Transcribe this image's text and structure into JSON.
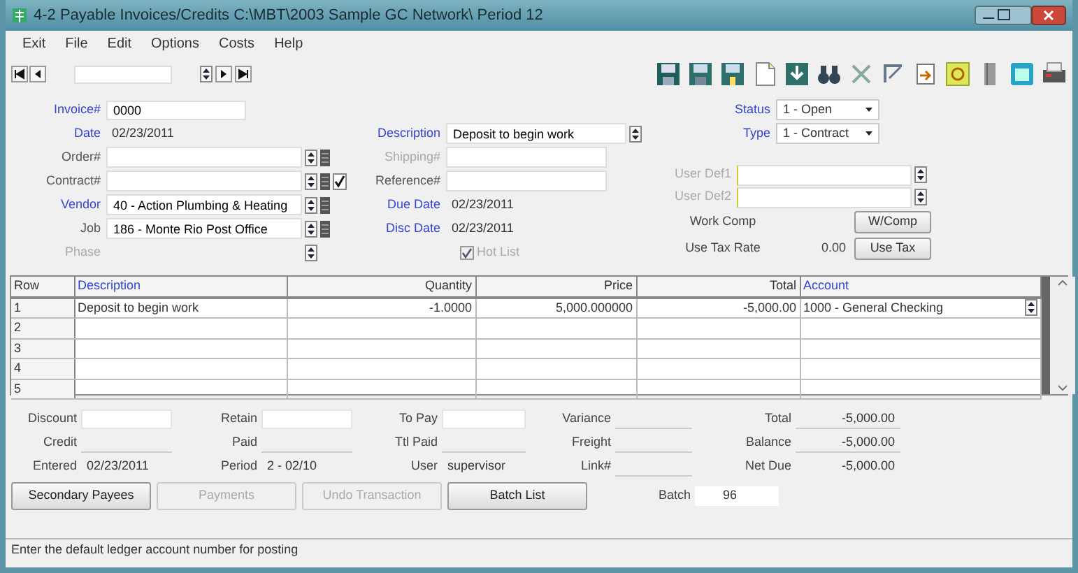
{
  "window": {
    "title": "4-2 Payable Invoices/Credits  C:\\MBT\\2003 Sample GC Network\\ Period 12"
  },
  "menu": [
    "Exit",
    "File",
    "Edit",
    "Options",
    "Costs",
    "Help"
  ],
  "left_fields": [
    {
      "label": "Invoice#",
      "value": "0000",
      "required": true,
      "disabled": false,
      "kind": "short_input",
      "lookup": false,
      "list": false,
      "check": false
    },
    {
      "label": "Date",
      "value": "02/23/2011",
      "required": true,
      "disabled": false,
      "kind": "text",
      "lookup": false,
      "list": false,
      "check": false
    },
    {
      "label": "Order#",
      "required": false,
      "disabled": false,
      "kind": "input",
      "lookup": true,
      "list": true,
      "check": false
    },
    {
      "label": "Contract#",
      "required": false,
      "disabled": false,
      "kind": "input",
      "lookup": true,
      "list": true,
      "check": true
    },
    {
      "label": "Vendor",
      "value": "40 - Action Plumbing & Heating",
      "required": true,
      "disabled": false,
      "kind": "input",
      "lookup": true,
      "list": true,
      "check": false
    },
    {
      "label": "Job",
      "value": "186 - Monte Rio Post Office",
      "required": false,
      "disabled": false,
      "kind": "input",
      "lookup": true,
      "list": true,
      "check": false
    },
    {
      "label": "Phase",
      "required": false,
      "disabled": true,
      "kind": "none",
      "lookup": true,
      "list": false,
      "check": false
    }
  ],
  "middle_fields": [
    {
      "label": "Description",
      "value": "Deposit to begin work",
      "required": true,
      "disabled": false,
      "kind": "wide_input"
    },
    {
      "label": "Shipping#",
      "required": false,
      "disabled": true,
      "kind": "input"
    },
    {
      "label": "Reference#",
      "required": false,
      "disabled": false,
      "kind": "input"
    },
    {
      "label": "Due Date",
      "value": "02/23/2011",
      "required": true,
      "disabled": false,
      "kind": "text"
    },
    {
      "label": "Disc Date",
      "value": "02/23/2011",
      "required": true,
      "disabled": false,
      "kind": "text"
    }
  ],
  "hot_list": {
    "label": "Hot List",
    "checked": true,
    "disabled": true
  },
  "status": {
    "label": "Status",
    "value": "1 - Open"
  },
  "type": {
    "label": "Type",
    "value": "1 - Contract"
  },
  "user_defs": [
    {
      "label": "User Def1"
    },
    {
      "label": "User Def2"
    }
  ],
  "work_comp": {
    "label": "Work Comp",
    "button": "W/Comp"
  },
  "use_tax": {
    "label": "Use Tax Rate",
    "value": "0.00",
    "button": "Use Tax"
  },
  "table": {
    "columns": [
      {
        "label": "Row",
        "link": false
      },
      {
        "label": "Description",
        "link": true
      },
      {
        "label": "Quantity",
        "link": false
      },
      {
        "label": "Price",
        "link": false
      },
      {
        "label": "Total",
        "link": false
      },
      {
        "label": "Account",
        "link": true
      }
    ],
    "rows": [
      {
        "row": "1",
        "description": "Deposit to begin work",
        "quantity": "-1.0000",
        "price": "5,000.000000",
        "total": "-5,000.00",
        "account": "1000 - General Checking"
      },
      {
        "row": "2"
      },
      {
        "row": "3"
      },
      {
        "row": "4"
      },
      {
        "row": "5"
      }
    ]
  },
  "totals": [
    [
      {
        "label": "Discount",
        "kind": "input"
      },
      {
        "label": "Retain",
        "kind": "input"
      },
      {
        "label": "To Pay",
        "kind": "input"
      },
      {
        "label": "Variance",
        "kind": "readonly"
      },
      {
        "label": "Total",
        "value": "-5,000.00",
        "kind": "readonly"
      }
    ],
    [
      {
        "label": "Credit",
        "kind": "readonly"
      },
      {
        "label": "Paid",
        "kind": "readonly"
      },
      {
        "label": "Ttl Paid",
        "kind": "readonly"
      },
      {
        "label": "Freight",
        "kind": "readonly"
      },
      {
        "label": "Balance",
        "value": "-5,000.00",
        "kind": "readonly"
      }
    ],
    [
      {
        "label": "Entered",
        "value": "02/23/2011",
        "kind": "text"
      },
      {
        "label": "Period",
        "value": "2 - 02/10",
        "kind": "text"
      },
      {
        "label": "User",
        "value": "supervisor",
        "kind": "text"
      },
      {
        "label": "Link#",
        "kind": "readonly"
      },
      {
        "label": "Net Due",
        "value": "-5,000.00",
        "kind": "text"
      }
    ]
  ],
  "buttons": [
    {
      "label": "Secondary Payees",
      "disabled": false
    },
    {
      "label": "Payments",
      "disabled": true
    },
    {
      "label": "Undo Transaction",
      "disabled": true
    },
    {
      "label": "Batch List",
      "disabled": false
    }
  ],
  "batch": {
    "label": "Batch",
    "value": "96"
  },
  "status_bar": "Enter the default ledger account number for posting"
}
